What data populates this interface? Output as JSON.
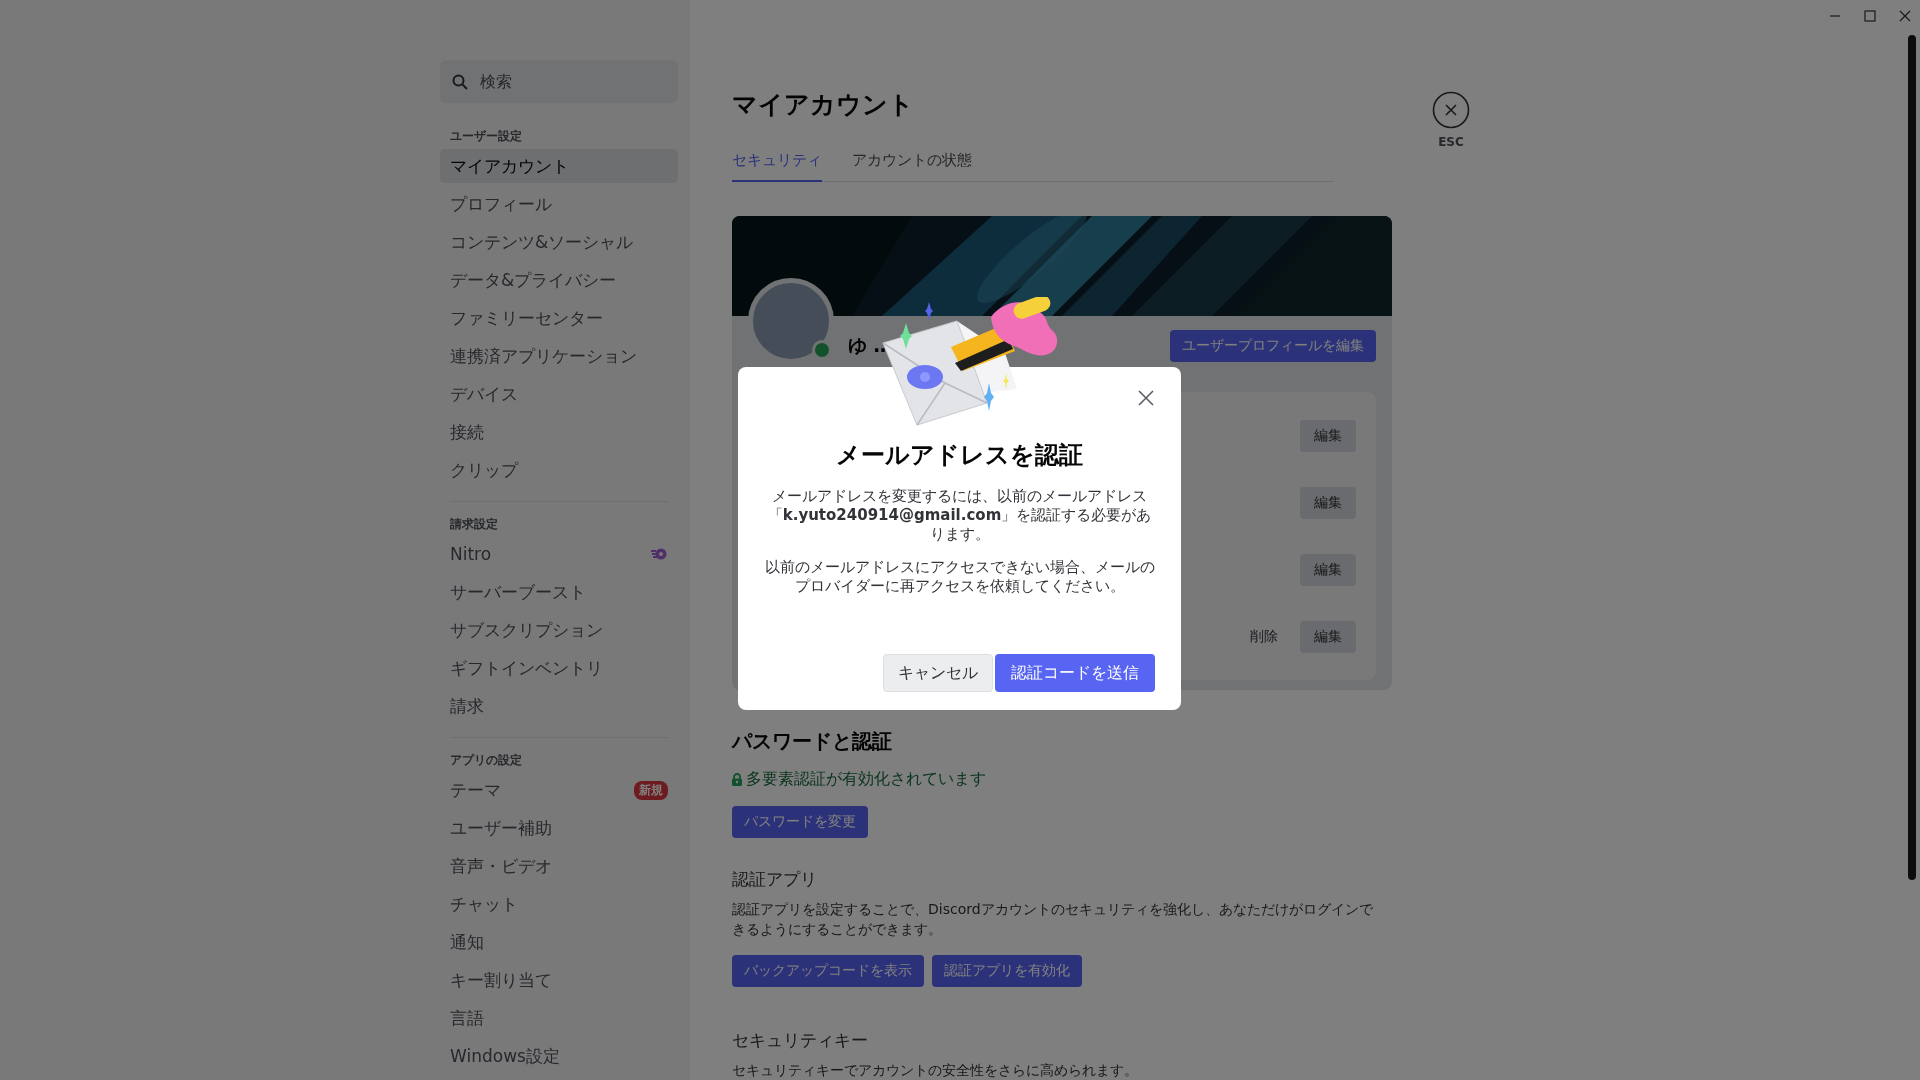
{
  "sidebar": {
    "search": {
      "placeholder": "検索"
    },
    "sections": [
      {
        "heading": "ユーザー設定",
        "items": [
          {
            "label": "マイアカウント",
            "selected": true
          },
          {
            "label": "プロフィール",
            "selected": false
          },
          {
            "label": "コンテンツ&ソーシャル",
            "selected": false
          },
          {
            "label": "データ&プライバシー",
            "selected": false
          },
          {
            "label": "ファミリーセンター",
            "selected": false
          },
          {
            "label": "連携済アプリケーション",
            "selected": false
          },
          {
            "label": "デバイス",
            "selected": false
          },
          {
            "label": "接続",
            "selected": false
          },
          {
            "label": "クリップ",
            "selected": false
          }
        ]
      },
      {
        "heading": "請求設定",
        "items": [
          {
            "label": "Nitro",
            "selected": false,
            "kind": "nitro"
          },
          {
            "label": "サーバーブースト",
            "selected": false
          },
          {
            "label": "サブスクリプション",
            "selected": false
          },
          {
            "label": "ギフトインベントリ",
            "selected": false
          },
          {
            "label": "請求",
            "selected": false
          }
        ]
      },
      {
        "heading": "アプリの設定",
        "items": [
          {
            "label": "テーマ",
            "selected": false,
            "badge": "新規"
          },
          {
            "label": "ユーザー補助",
            "selected": false
          },
          {
            "label": "音声・ビデオ",
            "selected": false
          },
          {
            "label": "チャット",
            "selected": false
          },
          {
            "label": "通知",
            "selected": false
          },
          {
            "label": "キー割り当て",
            "selected": false
          },
          {
            "label": "言語",
            "selected": false
          },
          {
            "label": "Windows設定",
            "selected": false
          }
        ]
      }
    ]
  },
  "page": {
    "title": "マイアカウント",
    "close_label": "ESC",
    "tabs": [
      {
        "label": "セキュリティ",
        "selected": true
      },
      {
        "label": "アカウントの状態",
        "selected": false
      }
    ],
    "profile": {
      "name": "ゆ …",
      "online": true,
      "edit_button": "ユーザープロフィールを編集",
      "rows": [
        {
          "actions": [
            "編集"
          ]
        },
        {
          "actions": [
            "編集"
          ]
        },
        {
          "actions": [
            "編集"
          ]
        },
        {
          "actions": [
            "削除",
            "編集"
          ]
        }
      ]
    },
    "password_section": {
      "title": "パスワードと認証",
      "mfa_status": "多要素認証が有効化されています",
      "change_password": "パスワードを変更",
      "auth_app_title": "認証アプリ",
      "auth_app_text": "認証アプリを設定することで、Discordアカウントのセキュリティを強化し、あなただけがログインできるようにすることができます。",
      "auth_buttons": [
        "バックアップコードを表示",
        "認証アプリを有効化"
      ],
      "security_key_title": "セキュリティキー",
      "security_key_text": "セキュリティキーでアカウントの安全性をさらに高められます。"
    }
  },
  "modal": {
    "title": "メールアドレスを認証",
    "paragraphs": [
      "メールアドレスを変更するには、以前のメールアドレス「**k.yuto240914@gmail.com**」を認証する必要があります。",
      "以前のメールアドレスにアクセスできない場合、メールのプロバイダーに再アクセスを依頼してください。"
    ],
    "cancel": "キャンセル",
    "confirm": "認証コードを送信"
  }
}
